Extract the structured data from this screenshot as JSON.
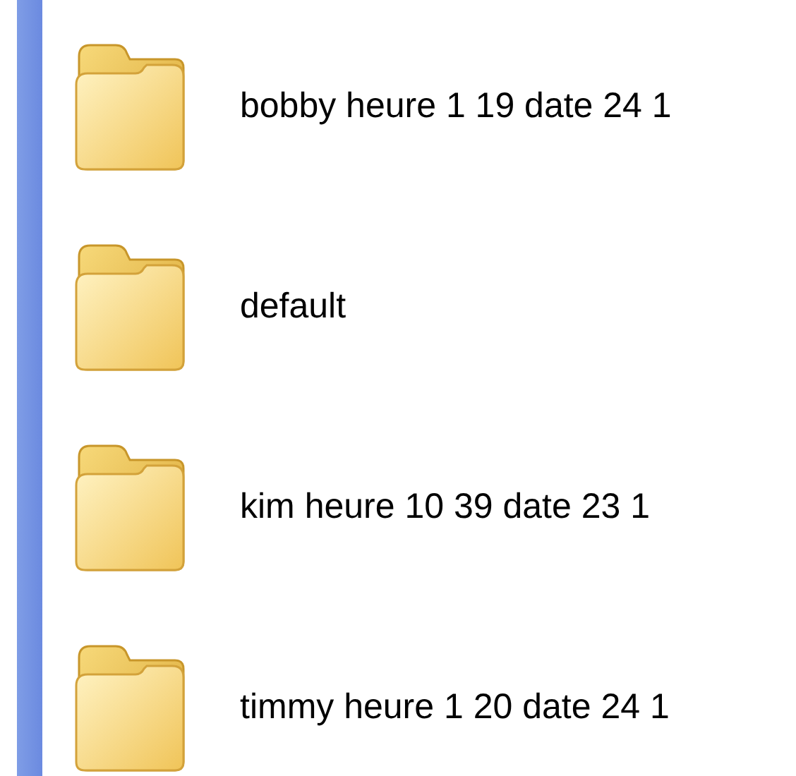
{
  "folders": [
    {
      "name": "bobby heure 1 19 date 24 1"
    },
    {
      "name": "default"
    },
    {
      "name": "kim heure 10 39 date 23 1"
    },
    {
      "name": "timmy heure 1 20 date 24 1"
    }
  ]
}
